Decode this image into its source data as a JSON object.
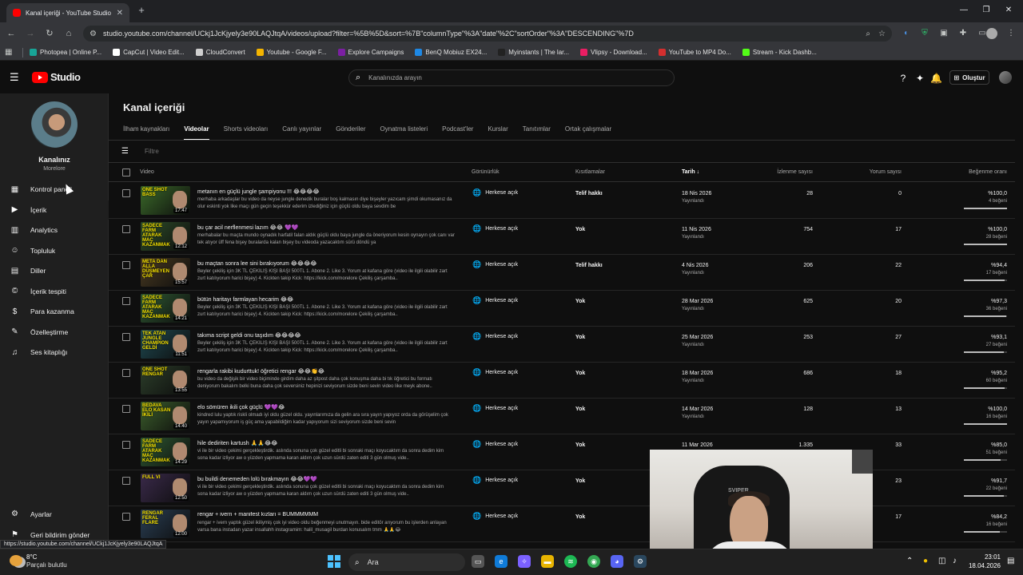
{
  "browser": {
    "tab_title": "Kanal içeriği - YouTube Studio",
    "url": "studio.youtube.com/channel/UCkj1JcKjyely3e90LAQJtqA/videos/upload?filter=%5B%5D&sort=%7B\"columnType\"%3A\"date\"%2C\"sortOrder\"%3A\"DESCENDING\"%7D",
    "status_url": "https://studio.youtube.com/channel/UCkj1JcKjyely3e90LAQJtqA"
  },
  "bookmarks": [
    {
      "label": "Photopea | Online P...",
      "color": "#18a497"
    },
    {
      "label": "CapCut | Video Edit...",
      "color": "#ffffff"
    },
    {
      "label": "CloudConvert",
      "color": "#cfcfcf"
    },
    {
      "label": "Youtube - Google F...",
      "color": "#f4b400"
    },
    {
      "label": "Explore Campaigns",
      "color": "#7b1fa2"
    },
    {
      "label": "BenQ Mobiuz EX24...",
      "color": "#1e88e5"
    },
    {
      "label": "Myinstants | The lar...",
      "color": "#222222"
    },
    {
      "label": "Vlipsy - Download...",
      "color": "#e91e63"
    },
    {
      "label": "YouTube to MP4 Do...",
      "color": "#d32f2f"
    },
    {
      "label": "Stream - Kick Dashb...",
      "color": "#53fc18"
    }
  ],
  "header": {
    "logo_text": "Studio",
    "search_placeholder": "Kanalınızda arayın",
    "create_label": "Oluştur"
  },
  "channel": {
    "name": "Kanalınız",
    "handle": "Morelore"
  },
  "sidebar": {
    "items": [
      {
        "label": "Kontrol paneli",
        "icon": "dashboard-icon",
        "glyph": "▦"
      },
      {
        "label": "İçerik",
        "icon": "content-icon",
        "glyph": "▶"
      },
      {
        "label": "Analytics",
        "icon": "analytics-icon",
        "glyph": "▥"
      },
      {
        "label": "Topluluk",
        "icon": "community-icon",
        "glyph": "☺"
      },
      {
        "label": "Diller",
        "icon": "subtitles-icon",
        "glyph": "▤"
      },
      {
        "label": "İçerik tespiti",
        "icon": "copyright-icon",
        "glyph": "©"
      },
      {
        "label": "Para kazanma",
        "icon": "monetization-icon",
        "glyph": "$"
      },
      {
        "label": "Özelleştirme",
        "icon": "customization-icon",
        "glyph": "✎"
      },
      {
        "label": "Ses kitaplığı",
        "icon": "audio-library-icon",
        "glyph": "♫"
      }
    ],
    "settings_label": "Ayarlar",
    "feedback_label": "Geri bildirim gönder"
  },
  "main": {
    "title": "Kanal içeriği",
    "tabs": [
      "İlham kaynakları",
      "Videolar",
      "Shorts videoları",
      "Canlı yayınlar",
      "Gönderiler",
      "Oynatma listeleri",
      "Podcast'ler",
      "Kurslar",
      "Tanıtımlar",
      "Ortak çalışmalar"
    ],
    "active_tab": 1,
    "filter_placeholder": "Filtre",
    "columns": {
      "video": "Video",
      "visibility": "Görünürlük",
      "restrictions": "Kısıtlamalar",
      "date": "Tarih",
      "views": "İzlenme sayısı",
      "comments": "Yorum sayısı",
      "likes": "Beğenme oranı"
    }
  },
  "videos": [
    {
      "title": "metanın en güçlü jungle şampiyonu !!! 😂😂😂😂",
      "desc": "merhaba arkadaşlar bu video da neyse jungle denedik buralar boş kalmasın diye bişeyler yazıcam şimdi okumasanız da olur eskinti yok like maçı gün geçin teşekkür ederim izlediğiniz için güçlü oldu baya sevdim be",
      "thumb_text": "ONE SHOT BASS",
      "duration": "17:47",
      "visibility": "Herkese açık",
      "restriction": "Telif hakkı",
      "date": "18 Nis 2026",
      "status": "Yayınlandı",
      "views": "28",
      "comments": "0",
      "ratio": "%100,0",
      "likes": "4 beğeni",
      "ratio_value": 1.0,
      "thumb_color": "#3b6a2a"
    },
    {
      "title": "bu çar acil nerflenmesi lazım 😂😂 💜💜",
      "desc": "merhabalar bu maçta mundo oynadık harfatil falan aldık güçlü oldu baya jungle da öneriyorum kesin oynayın çok canı var tek atıyor üff fena bişey buralarda kalan bişey bu videoda yazacaktım sürü döndü ya",
      "thumb_text": "SADECE FARM ATARAK MAÇ KAZANMAK",
      "duration": "12:12",
      "visibility": "Herkese açık",
      "restriction": "Yok",
      "date": "11 Nis 2026",
      "status": "Yayınlandı",
      "views": "754",
      "comments": "17",
      "ratio": "%100,0",
      "likes": "28 beğeni",
      "ratio_value": 1.0,
      "thumb_color": "#2f4f2a"
    },
    {
      "title": "bu maçtan sonra lee sini bırakıyorum 😂😂😂😂",
      "desc": "Beyler çekiliş için 3K TL ÇEKİLİŞ KİŞİ BAŞI 500TL 1. Abone 2. Like 3. Yorum at kafana göre (video ile ilgili olabilir zart zurt katılıyorum harici bişey) 4. Kickten takip Kick: https://kick.com/morelore Çekiliş çarşamba..",
      "thumb_text": "META DAN ALLA DÜŞMEYEN ÇAR",
      "duration": "15:57",
      "visibility": "Herkese açık",
      "restriction": "Telif hakkı",
      "date": "4 Nis 2026",
      "status": "Yayınlandı",
      "views": "206",
      "comments": "22",
      "ratio": "%94,4",
      "likes": "17 beğeni",
      "ratio_value": 0.944,
      "thumb_color": "#4a3b22"
    },
    {
      "title": "bütün haritayı farmlayan hecarim 😂😂",
      "desc": "Beyler çekiliş için 3K TL ÇEKİLİŞ KİŞİ BAŞI 500TL 1. Abone 2. Like 3. Yorum at kafana göre (video ile ilgili olabilir zart zurt katılıyorum harici bişey) 4. Kickten takip Kick: https://kick.com/morelore Çekiliş çarşamba..",
      "thumb_text": "SADECE FARM ATARAK MAÇ KAZANMAK",
      "duration": "14:21",
      "visibility": "Herkese açık",
      "restriction": "Yok",
      "date": "28 Mar 2026",
      "status": "Yayınlandı",
      "views": "625",
      "comments": "20",
      "ratio": "%97,3",
      "likes": "36 beğeni",
      "ratio_value": 0.973,
      "thumb_color": "#2f5a33"
    },
    {
      "title": "takıma script geldi onu taşıdım 😂😂😂😂",
      "desc": "Beyler çekiliş için 3K TL ÇEKİLİŞ KİŞİ BAŞI 500TL 1. Abone 2. Like 3. Yorum at kafana göre (video ile ilgili olabilir zart zurt katılıyorum harici bişey) 4. Kickten takip Kick: https://kick.com/morelore Çekiliş çarşamba..",
      "thumb_text": "TEK ATAN JUNGLE CHAMPION GELDİ",
      "duration": "11:51",
      "visibility": "Herkese açık",
      "restriction": "Yok",
      "date": "25 Mar 2026",
      "status": "Yayınlandı",
      "views": "253",
      "comments": "27",
      "ratio": "%93,1",
      "likes": "27 beğeni",
      "ratio_value": 0.931,
      "thumb_color": "#1f4a52"
    },
    {
      "title": "rengarla rakibi kudurttuk! öğretici rengar 😂😂👏😂",
      "desc": "bu video da değişik bir video biçiminde girdim daha az şitpost daha çok konuşma daha bi tık öğretici bu formatı deniyorum bakalım belki buna daha çok seversiniz hepinizi seviyorum sizde beni sevin video like meyk abone..",
      "thumb_text": "ONE SHOT RENGAR",
      "duration": "13:55",
      "visibility": "Herkese açık",
      "restriction": "Yok",
      "date": "18 Mar 2026",
      "status": "Yayınlandı",
      "views": "686",
      "comments": "18",
      "ratio": "%95,2",
      "likes": "60 beğeni",
      "ratio_value": 0.952,
      "thumb_color": "#2c3e2a"
    },
    {
      "title": "elo sömüren ikili çok güçlü 💜💜😂",
      "desc": "kindred lulu yaptık riskli olmadı iyi oldu güzel oldu. yayınlarımıza da gelin ara sıra yayın yapıyoz orda da görüşelim çok yayın yapamıyorum iş güç ama yapabildiğim kadar yapıyorum sizi seviyorum sizde beni sevin",
      "thumb_text": "BEDAVA ELO KASAN İKİLİ",
      "duration": "14:40",
      "visibility": "Herkese açık",
      "restriction": "Yok",
      "date": "14 Mar 2026",
      "status": "Yayınlandı",
      "views": "128",
      "comments": "13",
      "ratio": "%100,0",
      "likes": "16 beğeni",
      "ratio_value": 1.0,
      "thumb_color": "#3c5f2c"
    },
    {
      "title": "hile dediriten kartush 🙏🙏😂😂",
      "desc": "vi ile bir video çekimi gerçekleştirdik. aslında sonuna çok güzel editli bi sonraki maçı koyucaktım da sonra dedim kim sona kadar izliyor aw o yüzden yapmama karan aldım çok uzun sürdü zaten editi 3 gün olmuş vide..",
      "thumb_text": "SADECE FARM ATARAK MAÇ KAZANMAK",
      "duration": "14:29",
      "visibility": "Herkese açık",
      "restriction": "Yok",
      "date": "11 Mar 2026",
      "status": "",
      "views": "1.335",
      "comments": "33",
      "ratio": "%85,0",
      "likes": "51 beğeni",
      "ratio_value": 0.85,
      "thumb_color": "#2f5a33"
    },
    {
      "title": "bu buildi denemeden lolü bırakmayın 😂😂💜💜",
      "desc": "vi ile bir video çekimi gerçekleştirdik. aslında sonuna çok güzel editli bi sonraki maçı koyucaktım da sonra dedim kim sona kadar izliyor aw o yüzden yapmama karan aldım çok uzun sürdü zaten editi 3 gün olmuş vide..",
      "thumb_text": "FULL VI",
      "duration": "12:50",
      "visibility": "Herkese açık",
      "restriction": "Yok",
      "date": "",
      "status": "",
      "views": "",
      "comments": "23",
      "ratio": "%91,7",
      "likes": "22 beğeni",
      "ratio_value": 0.917,
      "thumb_color": "#3a2a4a"
    },
    {
      "title": "rengar + ivern + manifest kızları = BUMMMMMM",
      "desc": "rengar + ivern yaptık güzel ikiliymiş çok iyi video oldu beğenmeyi unutmayın. bide editör arıyorum bu işlerden anlayan varsa bana instadan yazar insallahh instagramim: halil_musagil burdan konusalım tmm 🙏🙏😂",
      "thumb_text": "RENGAR FERAL FLARE",
      "duration": "12:00",
      "visibility": "Herkese açık",
      "restriction": "Yok",
      "date": "",
      "status": "",
      "views": "",
      "comments": "17",
      "ratio": "%84,2",
      "likes": "16 beğeni",
      "ratio_value": 0.842,
      "thumb_color": "#2a3f55"
    }
  ],
  "webcam": {
    "chair_label": "SVIPER"
  },
  "taskbar": {
    "weather_temp": "8°C",
    "weather_desc": "Parçalı bulutlu",
    "search_label": "Ara",
    "time": "23:01",
    "date": "18.04.2026"
  }
}
